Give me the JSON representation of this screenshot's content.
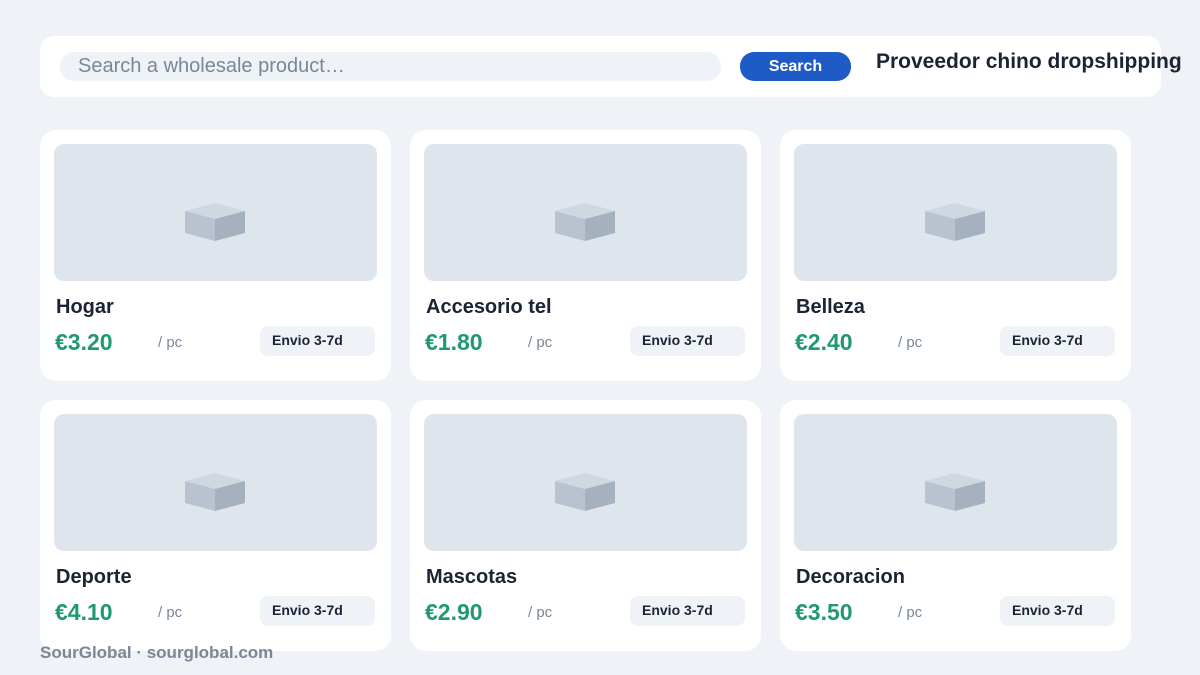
{
  "search": {
    "placeholder": "Search a wholesale product…",
    "button_label": "Search"
  },
  "header": {
    "tagline": "Proveedor chino dropshipping"
  },
  "products": [
    {
      "name": "Hogar",
      "price": "€3.20",
      "unit": "/ pc",
      "shipping": "Envio 3-7d"
    },
    {
      "name": "Accesorio tel",
      "price": "€1.80",
      "unit": "/ pc",
      "shipping": "Envio 3-7d"
    },
    {
      "name": "Belleza",
      "price": "€2.40",
      "unit": "/ pc",
      "shipping": "Envio 3-7d"
    },
    {
      "name": "Deporte",
      "price": "€4.10",
      "unit": "/ pc",
      "shipping": "Envio 3-7d"
    },
    {
      "name": "Mascotas",
      "price": "€2.90",
      "unit": "/ pc",
      "shipping": "Envio 3-7d"
    },
    {
      "name": "Decoracion",
      "price": "€3.50",
      "unit": "/ pc",
      "shipping": "Envio 3-7d"
    }
  ],
  "footer": {
    "text": "SourGlobal · sourglobal.com"
  },
  "colors": {
    "background": "#eff2f7",
    "accent": "#1e5bc6",
    "price": "#1f9a6e",
    "muted": "#7a8797"
  },
  "icons": {
    "product_placeholder": "box-icon"
  }
}
